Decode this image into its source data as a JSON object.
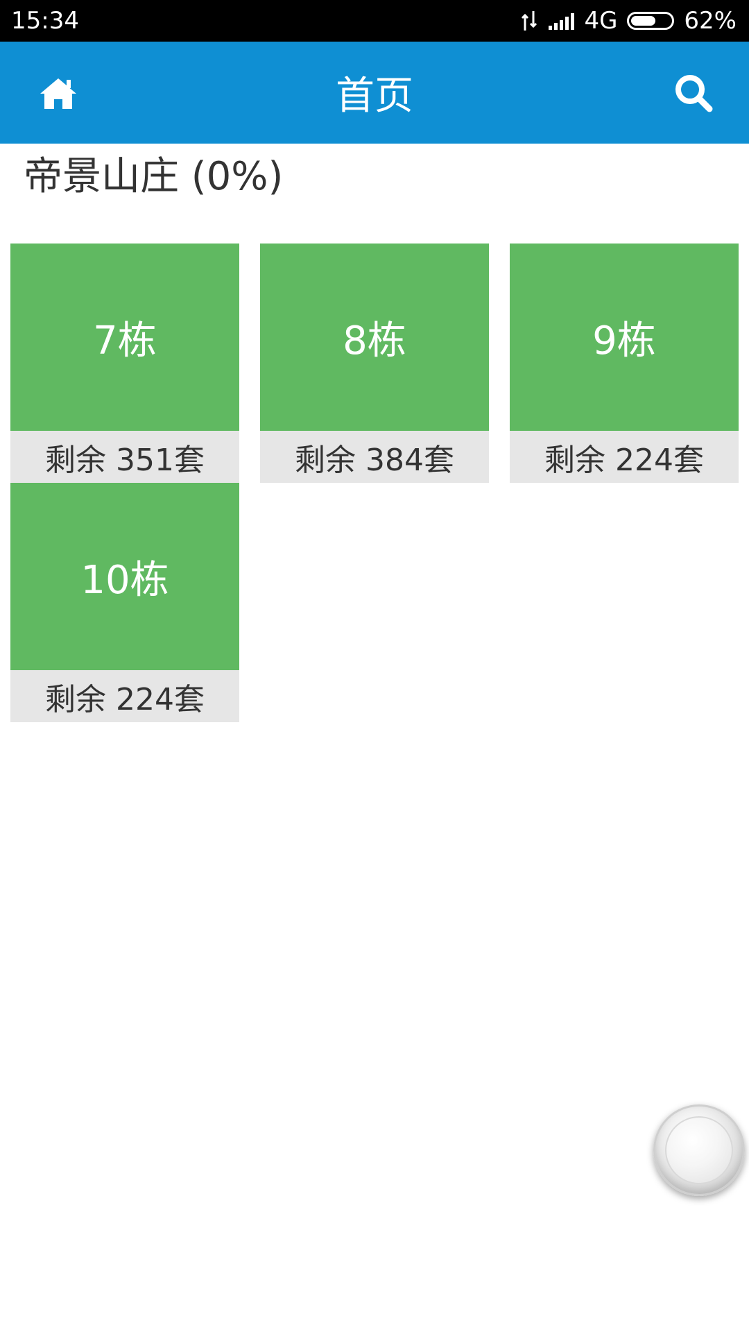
{
  "status_bar": {
    "time": "15:34",
    "network": "4G",
    "battery": "62%",
    "battery_level": 0.62,
    "icons": [
      "data-arrows-icon",
      "signal-icon",
      "battery-icon"
    ]
  },
  "header": {
    "title": "首页",
    "home_icon": "home-icon",
    "search_icon": "search-icon"
  },
  "project": {
    "title": "帝景山庄 (0%)"
  },
  "buildings": [
    {
      "name": "7栋",
      "remaining": "剩余 351套"
    },
    {
      "name": "8栋",
      "remaining": "剩余 384套"
    },
    {
      "name": "9栋",
      "remaining": "剩余 224套"
    },
    {
      "name": "10栋",
      "remaining": "剩余 224套"
    }
  ],
  "colors": {
    "accent": "#0f8fd3",
    "tile": "#60b961",
    "tile_footer": "#e6e6e6",
    "text": "#333333"
  },
  "floating_button": {
    "icon": "assistive-touch-icon"
  }
}
